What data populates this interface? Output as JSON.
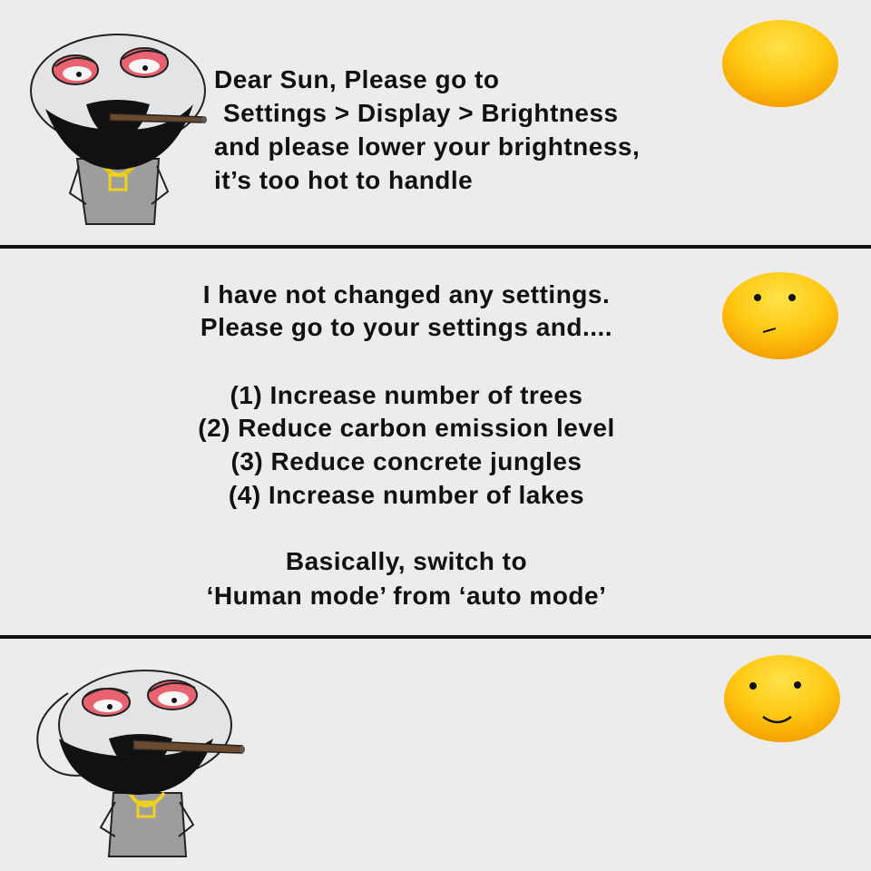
{
  "panels": [
    {
      "speaker": "man",
      "lines": [
        "Dear Sun, Please go to",
        "Settings > Display > Brightness",
        "and please lower your brightness,",
        "it’s too hot to handle"
      ],
      "sun_expression": "blank"
    },
    {
      "speaker": "sun",
      "intro": [
        "I have not changed any settings.",
        "Please go to your settings and...."
      ],
      "steps": [
        "(1) Increase number of trees",
        "(2) Reduce carbon emission level",
        "(3) Reduce concrete jungles",
        "(4) Increase number of lakes"
      ],
      "outro": [
        "Basically, switch to",
        "‘Human mode’ from ‘auto mode’"
      ],
      "sun_expression": "unimpressed"
    },
    {
      "speaker": "none",
      "lines": [],
      "sun_expression": "smiling"
    }
  ],
  "colors": {
    "background": "#ececec",
    "divider": "#111111",
    "sun_light": "#ffd83a",
    "sun_dark": "#f5a300",
    "eye_red": "#e8626f",
    "necklace": "#f0d020",
    "shirt": "#9d9d9d",
    "cigar": "#6b4a2f"
  }
}
